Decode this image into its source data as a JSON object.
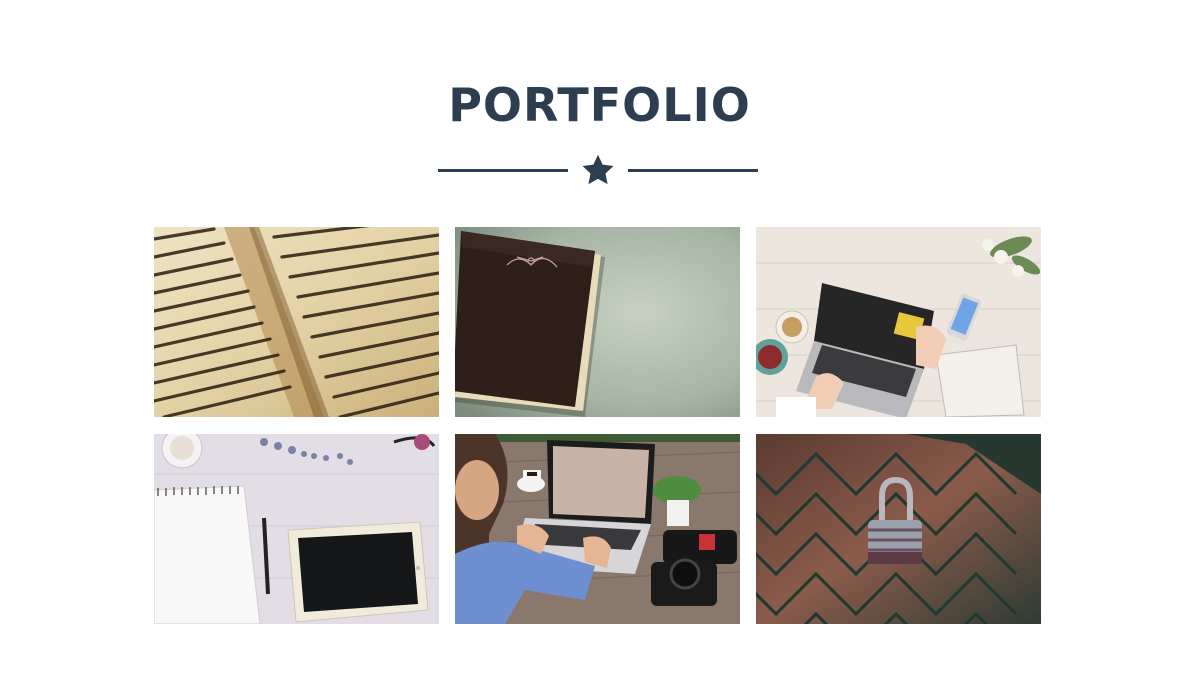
{
  "section": {
    "title": "PORTFOLIO",
    "divider_icon": "star-icon"
  },
  "colors": {
    "primary": "#2c3e50",
    "background": "#ffffff"
  },
  "portfolio_items": [
    {
      "icon": "old-book-text-image"
    },
    {
      "icon": "leather-notebook-image"
    },
    {
      "icon": "laptop-desk-image"
    },
    {
      "icon": "tablet-notebook-image"
    },
    {
      "icon": "man-laptop-image"
    },
    {
      "icon": "padlock-fence-image"
    }
  ]
}
